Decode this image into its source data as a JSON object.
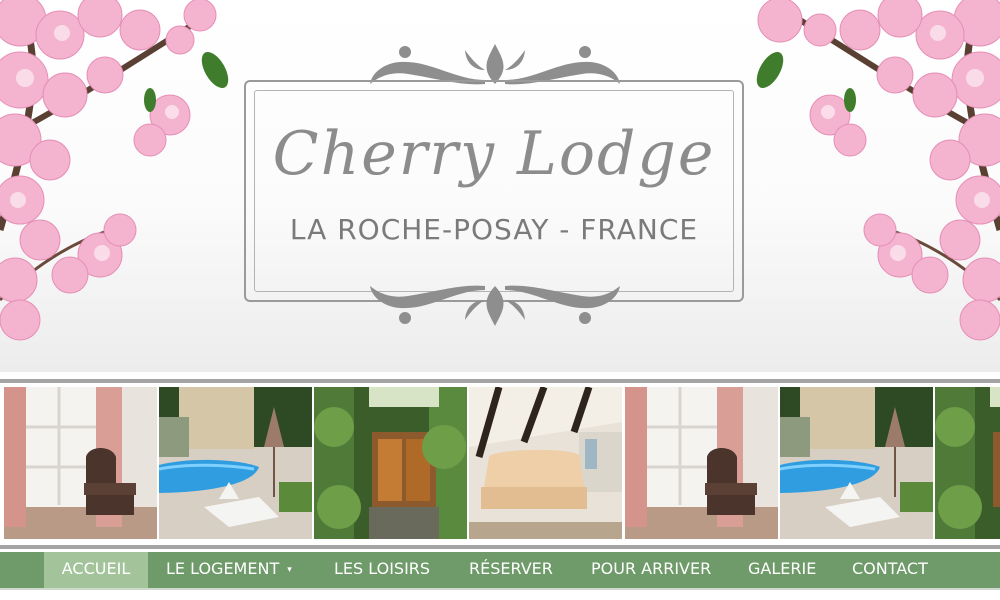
{
  "logo": {
    "title": "Cherry Lodge",
    "subtitle": "LA ROCHE-POSAY - FRANCE"
  },
  "nav": {
    "items": [
      {
        "label": "ACCUEIL",
        "active": true
      },
      {
        "label": "LE LOGEMENT",
        "dropdown": true
      },
      {
        "label": "LES LOISIRS"
      },
      {
        "label": "RÉSERVER"
      },
      {
        "label": "POUR ARRIVER"
      },
      {
        "label": "GALERIE"
      },
      {
        "label": "CONTACT"
      }
    ],
    "dropdown_icon": "▾"
  },
  "colors": {
    "nav_background": "#6f9a6a",
    "nav_active": "#a3c49b",
    "logo_gray": "#8c8c8c",
    "blossom_pink": "#f2aecb"
  },
  "icons": {
    "header_decoration": "cherry-blossom-icon",
    "frame_decoration": "scroll-ornament-icon"
  }
}
